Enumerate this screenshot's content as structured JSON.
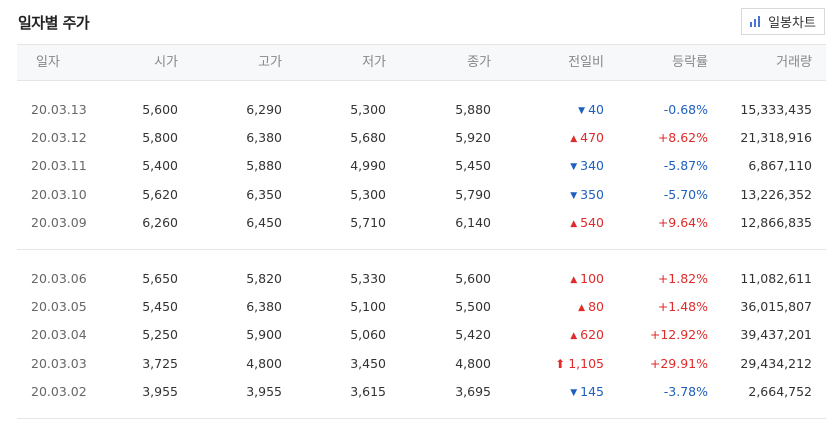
{
  "title": "일자별 주가",
  "chart_button": {
    "label": "일봉차트",
    "icon": "bar-chart-icon"
  },
  "columns": [
    "일자",
    "시가",
    "고가",
    "저가",
    "종가",
    "전일비",
    "등락률",
    "거래량"
  ],
  "groups": [
    [
      {
        "date": "20.03.13",
        "open": "5,600",
        "high": "6,290",
        "low": "5,300",
        "close": "5,880",
        "dir": "down",
        "change": "40",
        "rate": "-0.68%",
        "volume": "15,333,435"
      },
      {
        "date": "20.03.12",
        "open": "5,800",
        "high": "6,380",
        "low": "5,680",
        "close": "5,920",
        "dir": "up",
        "change": "470",
        "rate": "+8.62%",
        "volume": "21,318,916"
      },
      {
        "date": "20.03.11",
        "open": "5,400",
        "high": "5,880",
        "low": "4,990",
        "close": "5,450",
        "dir": "down",
        "change": "340",
        "rate": "-5.87%",
        "volume": "6,867,110"
      },
      {
        "date": "20.03.10",
        "open": "5,620",
        "high": "6,350",
        "low": "5,300",
        "close": "5,790",
        "dir": "down",
        "change": "350",
        "rate": "-5.70%",
        "volume": "13,226,352"
      },
      {
        "date": "20.03.09",
        "open": "6,260",
        "high": "6,450",
        "low": "5,710",
        "close": "6,140",
        "dir": "up",
        "change": "540",
        "rate": "+9.64%",
        "volume": "12,866,835"
      }
    ],
    [
      {
        "date": "20.03.06",
        "open": "5,650",
        "high": "5,820",
        "low": "5,330",
        "close": "5,600",
        "dir": "up",
        "change": "100",
        "rate": "+1.82%",
        "volume": "11,082,611"
      },
      {
        "date": "20.03.05",
        "open": "5,450",
        "high": "6,380",
        "low": "5,100",
        "close": "5,500",
        "dir": "up",
        "change": "80",
        "rate": "+1.48%",
        "volume": "36,015,807"
      },
      {
        "date": "20.03.04",
        "open": "5,250",
        "high": "5,900",
        "low": "5,060",
        "close": "5,420",
        "dir": "up",
        "change": "620",
        "rate": "+12.92%",
        "volume": "39,437,201"
      },
      {
        "date": "20.03.03",
        "open": "3,725",
        "high": "4,800",
        "low": "3,450",
        "close": "4,800",
        "dir": "limit-up",
        "change": "1,105",
        "rate": "+29.91%",
        "volume": "29,434,212"
      },
      {
        "date": "20.03.02",
        "open": "3,955",
        "high": "3,955",
        "low": "3,615",
        "close": "3,695",
        "dir": "down",
        "change": "145",
        "rate": "-3.78%",
        "volume": "2,664,752"
      }
    ]
  ],
  "colors": {
    "up": "#e02b2b",
    "down": "#1f5fbf"
  }
}
